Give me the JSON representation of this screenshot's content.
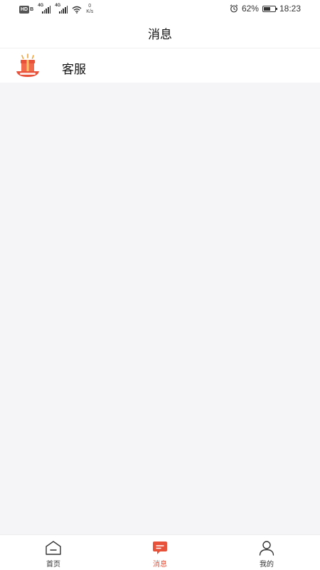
{
  "status_bar": {
    "hd_badge": "HD",
    "sim_label": "B",
    "signal1_label": "4G",
    "signal2_label": "4G",
    "net_speed_value": "0",
    "net_speed_unit": "K/s",
    "battery_percent": "62%",
    "battery_level": 0.62,
    "time": "18:23"
  },
  "header": {
    "title": "消息"
  },
  "conversations": [
    {
      "name": "客服",
      "avatar_icon": "gift-box-logo-icon"
    }
  ],
  "tab_bar": {
    "items": [
      {
        "label": "首页",
        "icon": "home-icon",
        "active": false
      },
      {
        "label": "消息",
        "icon": "chat-bubble-icon",
        "active": true
      },
      {
        "label": "我的",
        "icon": "user-icon",
        "active": false
      }
    ],
    "active_color": "#e8513a"
  },
  "colors": {
    "content_bg": "#f5f4f7",
    "accent": "#e8513a"
  }
}
